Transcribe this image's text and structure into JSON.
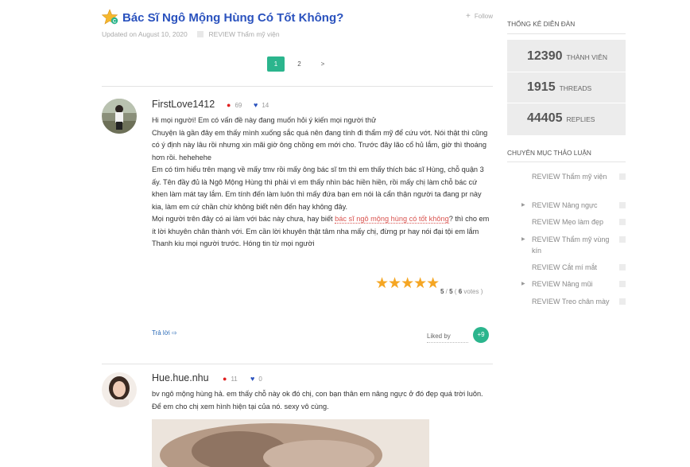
{
  "topic": {
    "title": "Bác Sĩ Ngô Mộng Hùng Có Tốt Không?",
    "follow_label": "Follow",
    "updated": "Updated on August 10, 2020",
    "category": "REVIEW Thẩm mỹ viện"
  },
  "pager": {
    "pages": [
      "1",
      "2"
    ],
    "next": ">",
    "current": "1"
  },
  "posts": [
    {
      "username": "FirstLove1412",
      "comments": "69",
      "likes": "14",
      "lines": [
        "Hi mọi người! Em có vấn đề này đang muốn hỏi ý kiến mọi người thử",
        "Chuyện là gần đây em thấy mình xuống sắc quá nên đang tính đi thẩm mỹ để cứu vớt. Nói thật thì cũng có ý định này lâu rồi nhưng xin mãi giờ ông chồng em mới cho. Trước đây lão cổ hủ lắm, giờ thì thoáng hơn rồi. hehehehe",
        "Em có tìm hiểu trên mạng về mấy tmv rồi mấy ông bác sĩ tm thì em thấy thích bác sĩ Hùng, chỗ quận 3 ấy. Tên đầy đủ là Ngô Mộng Hùng thì phải vì em thấy nhìn bác hiền hiền, rồi mấy chị làm chỗ bác cứ khen làm mát tay lắm. Em tính đến làm luôn thì mấy đứa bạn em nói là cẩn thận người ta đang pr này kia, làm em cứ chần chừ không biết nên đến hay không đây."
      ],
      "link_pre": "Mọi người trên đây có ai làm với bác này chưa, hay biết ",
      "link_text": "bác sĩ ngô mộng hùng có tốt không",
      "link_post": "? thì cho em ít lời khuyên chân thành với. Em cần lời khuyên thật tâm nha mấy chị, đừng pr hay nói đại tội em lắm",
      "closing": "Thanh kiu mọi người trước. Hóng tin từ mọi người",
      "rating": {
        "stars": "★★★★★",
        "score": "5",
        "max": "5",
        "votes": "6",
        "votes_label": "votes"
      },
      "reply_label": "Trả lời",
      "liked_by_label": "Liked by",
      "liked_count": "+9"
    },
    {
      "username": "Hue.hue.nhu",
      "comments": "11",
      "likes": "0",
      "text": "bv ngô mộng hùng hả. em thấy chỗ này ok đó chị, con bạn thân em nâng ngực ở đó đẹp quá trời luôn. Để em cho chị xem hình hiện tại của nó. sexy vô cùng."
    }
  ],
  "sidebar": {
    "stats_title": "THỐNG KÊ DIỄN ĐÀN",
    "members": {
      "value": "12390",
      "label": "THÀNH VIÊN"
    },
    "threads": {
      "value": "1915",
      "label": "THREADS"
    },
    "replies": {
      "value": "44405",
      "label": "REPLIES"
    },
    "cats_title": "CHUYÊN MỤC THẢO LUẬN",
    "categories": [
      "REVIEW Thẩm mỹ viện",
      "REVIEW Nâng ngực",
      "REVIEW Mẹo làm đẹp",
      "REVIEW Thẩm mỹ vùng kín",
      "REVIEW Cắt mí mắt",
      "REVIEW Nâng mũi",
      "REVIEW Treo chân mày"
    ]
  },
  "colors": {
    "accent": "#2bb58d",
    "title": "#2a52be",
    "link": "#d9534f",
    "star": "#f5a623"
  }
}
